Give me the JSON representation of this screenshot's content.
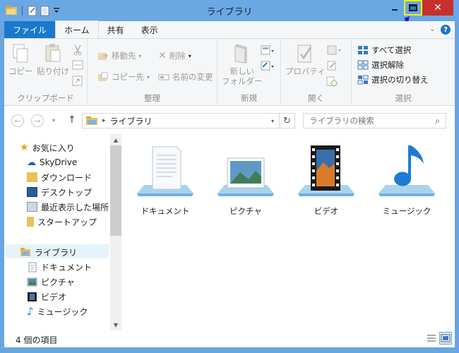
{
  "window": {
    "title": "ライブラリ"
  },
  "ribbon_tabs": [
    {
      "label": "ファイル"
    },
    {
      "label": "ホーム"
    },
    {
      "label": "共有"
    },
    {
      "label": "表示"
    }
  ],
  "ribbon": {
    "clipboard": {
      "copy": "コピー",
      "paste": "貼り付け",
      "label": "クリップボード"
    },
    "organize": {
      "move_to": "移動先",
      "copy_to": "コピー先",
      "delete": "削除",
      "rename": "名前の変更",
      "label": "整理"
    },
    "new": {
      "new_folder_line1": "新しい",
      "new_folder_line2": "フォルダー",
      "label": "新規"
    },
    "open": {
      "properties": "プロパティ",
      "label": "開く"
    },
    "select": {
      "select_all": "すべて選択",
      "select_none": "選択解除",
      "invert": "選択の切り替え",
      "label": "選択"
    }
  },
  "address": {
    "path": "ライブラリ",
    "search_placeholder": "ライブラリの検索"
  },
  "nav": {
    "favorites": "お気に入り",
    "fav_items": [
      "SkyDrive",
      "ダウンロード",
      "デスクトップ",
      "最近表示した場所",
      "スタートアップ"
    ],
    "libraries": "ライブラリ",
    "lib_items": [
      "ドキュメント",
      "ピクチャ",
      "ビデオ",
      "ミュージック"
    ]
  },
  "libraries": [
    {
      "label": "ドキュメント",
      "icon": "documents-library-icon"
    },
    {
      "label": "ピクチャ",
      "icon": "pictures-library-icon"
    },
    {
      "label": "ビデオ",
      "icon": "videos-library-icon"
    },
    {
      "label": "ミュージック",
      "icon": "music-library-icon"
    }
  ],
  "status": {
    "item_count": "4 個の項目"
  },
  "colors": {
    "titlebar": "#6aa8e4",
    "file_tab": "#1979ca",
    "close": "#c7302b",
    "highlight": "#f6f200"
  }
}
